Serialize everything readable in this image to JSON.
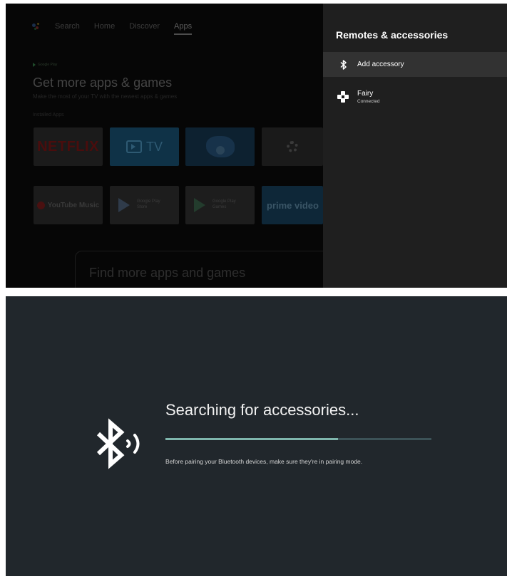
{
  "tv_home": {
    "nav": {
      "items": [
        "Search",
        "Home",
        "Discover",
        "Apps"
      ],
      "active_index": 3
    },
    "play_label": "Google Play",
    "headline": "Get more apps & games",
    "subtitle": "Make the most of your TV with the newest apps & games",
    "installed_label": "Installed Apps",
    "tiles_row1": {
      "netflix": "NETFLIX",
      "tv": "TV"
    },
    "tiles_row2": {
      "youtube_music": "YouTube Music",
      "google_play_store": "Google Play Store",
      "google_play_games": "Google Play Games",
      "prime_video": "prime video"
    },
    "find_more": "Find more apps and games"
  },
  "panel": {
    "title": "Remotes & accessories",
    "add_label": "Add accessory",
    "device_name": "Fairy",
    "device_status": "Connected"
  },
  "search_screen": {
    "title": "Searching for accessories...",
    "hint": "Before pairing your Bluetooth devices, make sure they're in pairing mode.",
    "progress": 0.65
  },
  "colors": {
    "panel_bg": "#1f1f1f",
    "selected_row": "#323232",
    "search_bg": "#21272c",
    "progress_track": "#3c5257",
    "progress_fill": "#7fb6ad"
  },
  "icons": {
    "bluetooth": "bluetooth-icon",
    "gamepad": "gamepad-icon",
    "bluetooth_searching": "bluetooth-searching-icon",
    "assistant": "google-assistant-icon",
    "settings": "gear-icon"
  }
}
